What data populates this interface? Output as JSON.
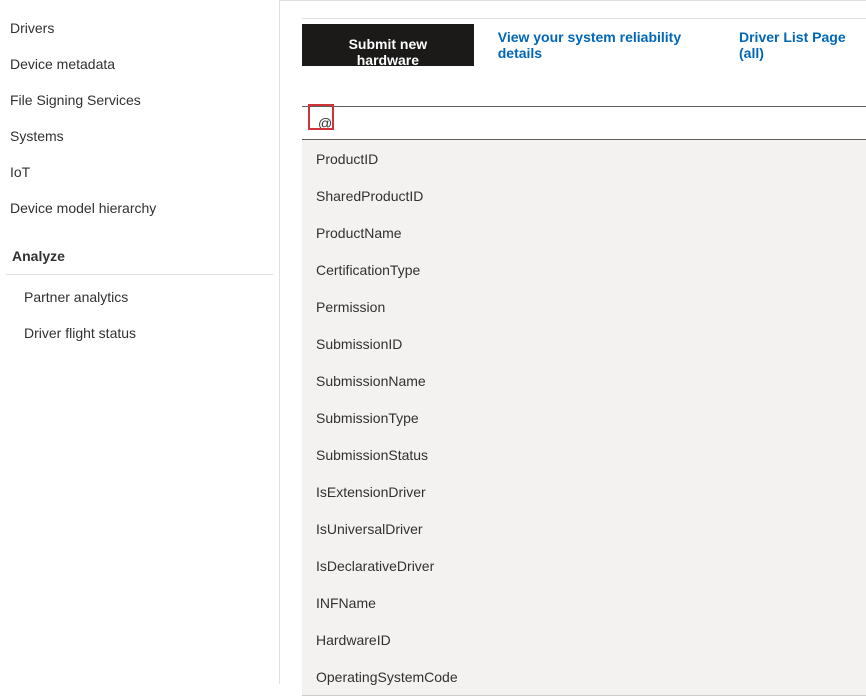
{
  "sidebar": {
    "items": [
      {
        "label": "Drivers"
      },
      {
        "label": "Device metadata"
      },
      {
        "label": "File Signing Services"
      },
      {
        "label": "Systems"
      },
      {
        "label": "IoT"
      },
      {
        "label": "Device model hierarchy"
      }
    ],
    "section_header": "Analyze",
    "subitems": [
      {
        "label": "Partner analytics"
      },
      {
        "label": "Driver flight status"
      }
    ]
  },
  "topbar": {
    "submit_label": "Submit new hardware",
    "reliability_link": "View your system reliability details",
    "driver_list_link": "Driver List Page (all)"
  },
  "search": {
    "value": "@"
  },
  "dropdown": {
    "items": [
      "ProductID",
      "SharedProductID",
      "ProductName",
      "CertificationType",
      "Permission",
      "SubmissionID",
      "SubmissionName",
      "SubmissionType",
      "SubmissionStatus",
      "IsExtensionDriver",
      "IsUniversalDriver",
      "IsDeclarativeDriver",
      "INFName",
      "HardwareID",
      "OperatingSystemCode"
    ]
  }
}
